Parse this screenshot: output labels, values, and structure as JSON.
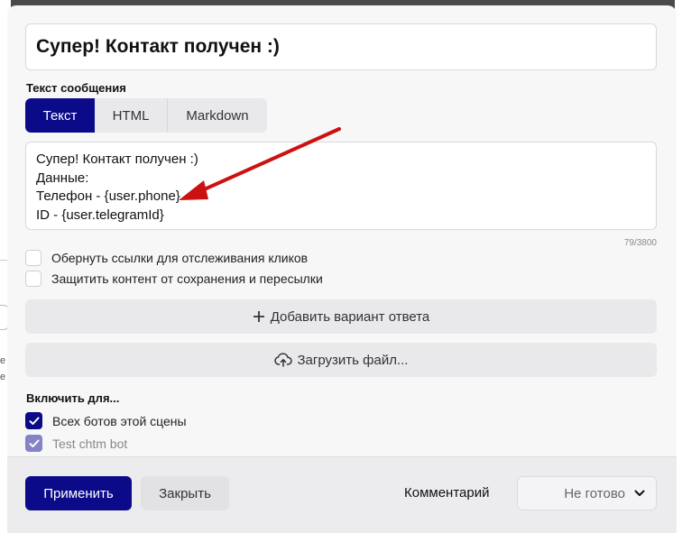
{
  "background": {
    "fragment_a": "е",
    "fragment_b": "е"
  },
  "modal": {
    "title_value": "Супер! Контакт получен :)",
    "message_section_label": "Текст сообщения",
    "format_tabs": [
      {
        "label": "Текст",
        "active": true
      },
      {
        "label": "HTML",
        "active": false
      },
      {
        "label": "Markdown",
        "active": false
      }
    ],
    "message_lines": [
      "Супер! Контакт получен :)",
      "Данные:",
      "Телефон - {user.phone}",
      "ID - {user.telegramId}"
    ],
    "char_counter": "79/3800",
    "options": [
      {
        "label": "Обернуть ссылки для отслеживания кликов",
        "checked": false
      },
      {
        "label": "Защитить контент от сохранения и пересылки",
        "checked": false
      }
    ],
    "add_answer_label": "Добавить вариант ответа",
    "upload_file_label": "Загрузить файл...",
    "enable_for_label": "Включить для...",
    "enable_targets": [
      {
        "label": "Всех ботов этой сцены",
        "checked": true,
        "disabled": false
      },
      {
        "label": "Test chtm bot",
        "checked": true,
        "disabled": true
      }
    ]
  },
  "footer": {
    "apply_label": "Применить",
    "close_label": "Закрыть",
    "comment_label": "Комментарий",
    "status_value": "Не готово"
  },
  "icons": {
    "add": "plus-icon",
    "upload": "cloud-upload-icon",
    "check": "checkmark-icon",
    "dropdown": "chevron-down-icon",
    "annotation": "red-arrow"
  },
  "colors": {
    "accent": "#0b0b8a",
    "accent_disabled": "#8484c4",
    "annotation_arrow": "#cc1111"
  }
}
